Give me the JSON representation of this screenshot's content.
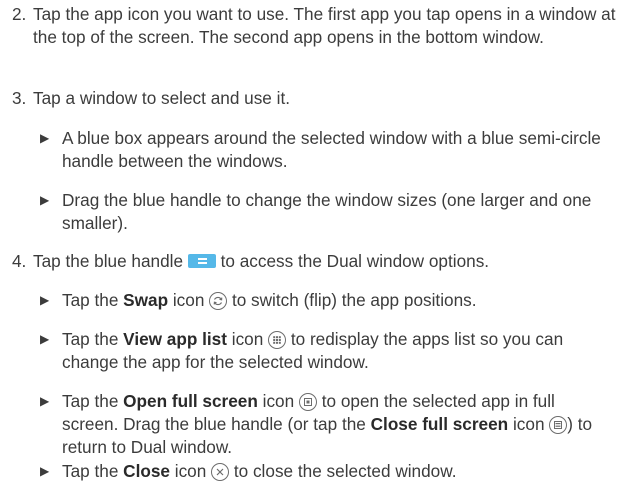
{
  "steps": [
    {
      "num": "2.",
      "text": "Tap the app icon you want to use. The first app you tap opens in a window at the top of the screen. The second app opens in the bottom window."
    },
    {
      "num": "3.",
      "text": "Tap a window to select and use it.",
      "bullets": [
        "A blue box appears around the selected window with a blue semi-circle handle between the windows.",
        "Drag the blue handle to change the window sizes (one larger and one smaller)."
      ]
    },
    {
      "num": "4.",
      "text_before": "Tap the blue handle",
      "text_after": "to access the Dual window options.",
      "bullets": [
        {
          "pre": "Tap the",
          "bold": "Swap",
          "post": "icon",
          "tail": "to switch (flip) the app positions."
        },
        {
          "pre": "Tap the",
          "bold": "View app list",
          "post": "icon",
          "tail": "to redisplay the apps list so you can change the app for the selected window."
        },
        {
          "pre": "Tap the",
          "bold": "Open full screen",
          "post": "icon",
          "tail": "to open the selected app in full screen. Drag the blue handle (or tap the",
          "bold2": "Close full screen",
          "post2": "icon",
          "tail2": ") to return to Dual window."
        },
        {
          "pre": "Tap the",
          "bold": "Close",
          "post": "icon",
          "tail": "to close the selected window."
        }
      ]
    }
  ],
  "bullet_glyph": "▶",
  "icons": [
    "blue-handle-icon",
    "swap-icon",
    "app-list-icon",
    "full-screen-icon",
    "close-full-screen-icon",
    "close-icon"
  ],
  "colors": {
    "text": "#3c3c3c",
    "handle": "#55b8e8",
    "icon_stroke": "#6c6c6c"
  }
}
